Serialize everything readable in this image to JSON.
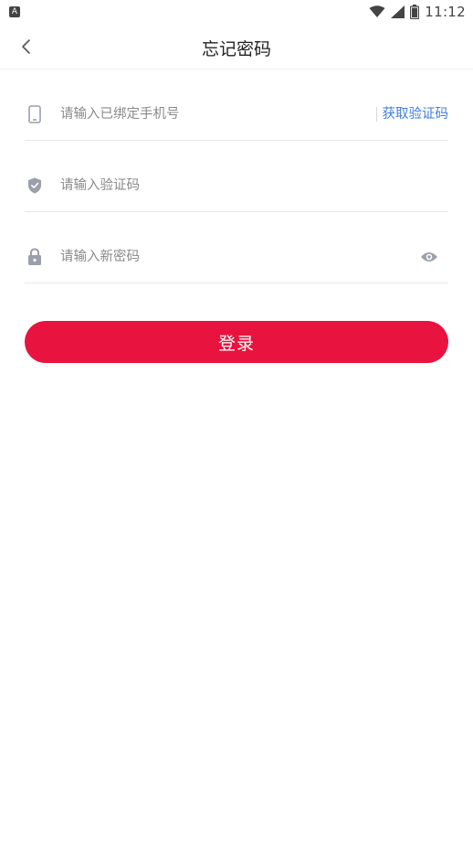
{
  "statusbar": {
    "time": "11:12",
    "app_badge": "A",
    "icons": [
      "wifi-icon",
      "cellular-signal-icon",
      "battery-icon"
    ]
  },
  "navbar": {
    "back_icon": "chevron-left-icon",
    "title": "忘记密码"
  },
  "form": {
    "phone": {
      "icon": "phone-icon",
      "value": "",
      "placeholder": "请输入已绑定手机号",
      "get_code_label": "获取验证码"
    },
    "code": {
      "icon": "shield-icon",
      "value": "",
      "placeholder": "请输入验证码"
    },
    "password": {
      "icon": "lock-icon",
      "value": "",
      "placeholder": "请输入新密码",
      "toggle_icon": "eye-icon"
    }
  },
  "submit": {
    "label": "登录"
  },
  "colors": {
    "accent": "#e8133f",
    "link": "#3f7de0",
    "icon": "#9aa0ab"
  }
}
